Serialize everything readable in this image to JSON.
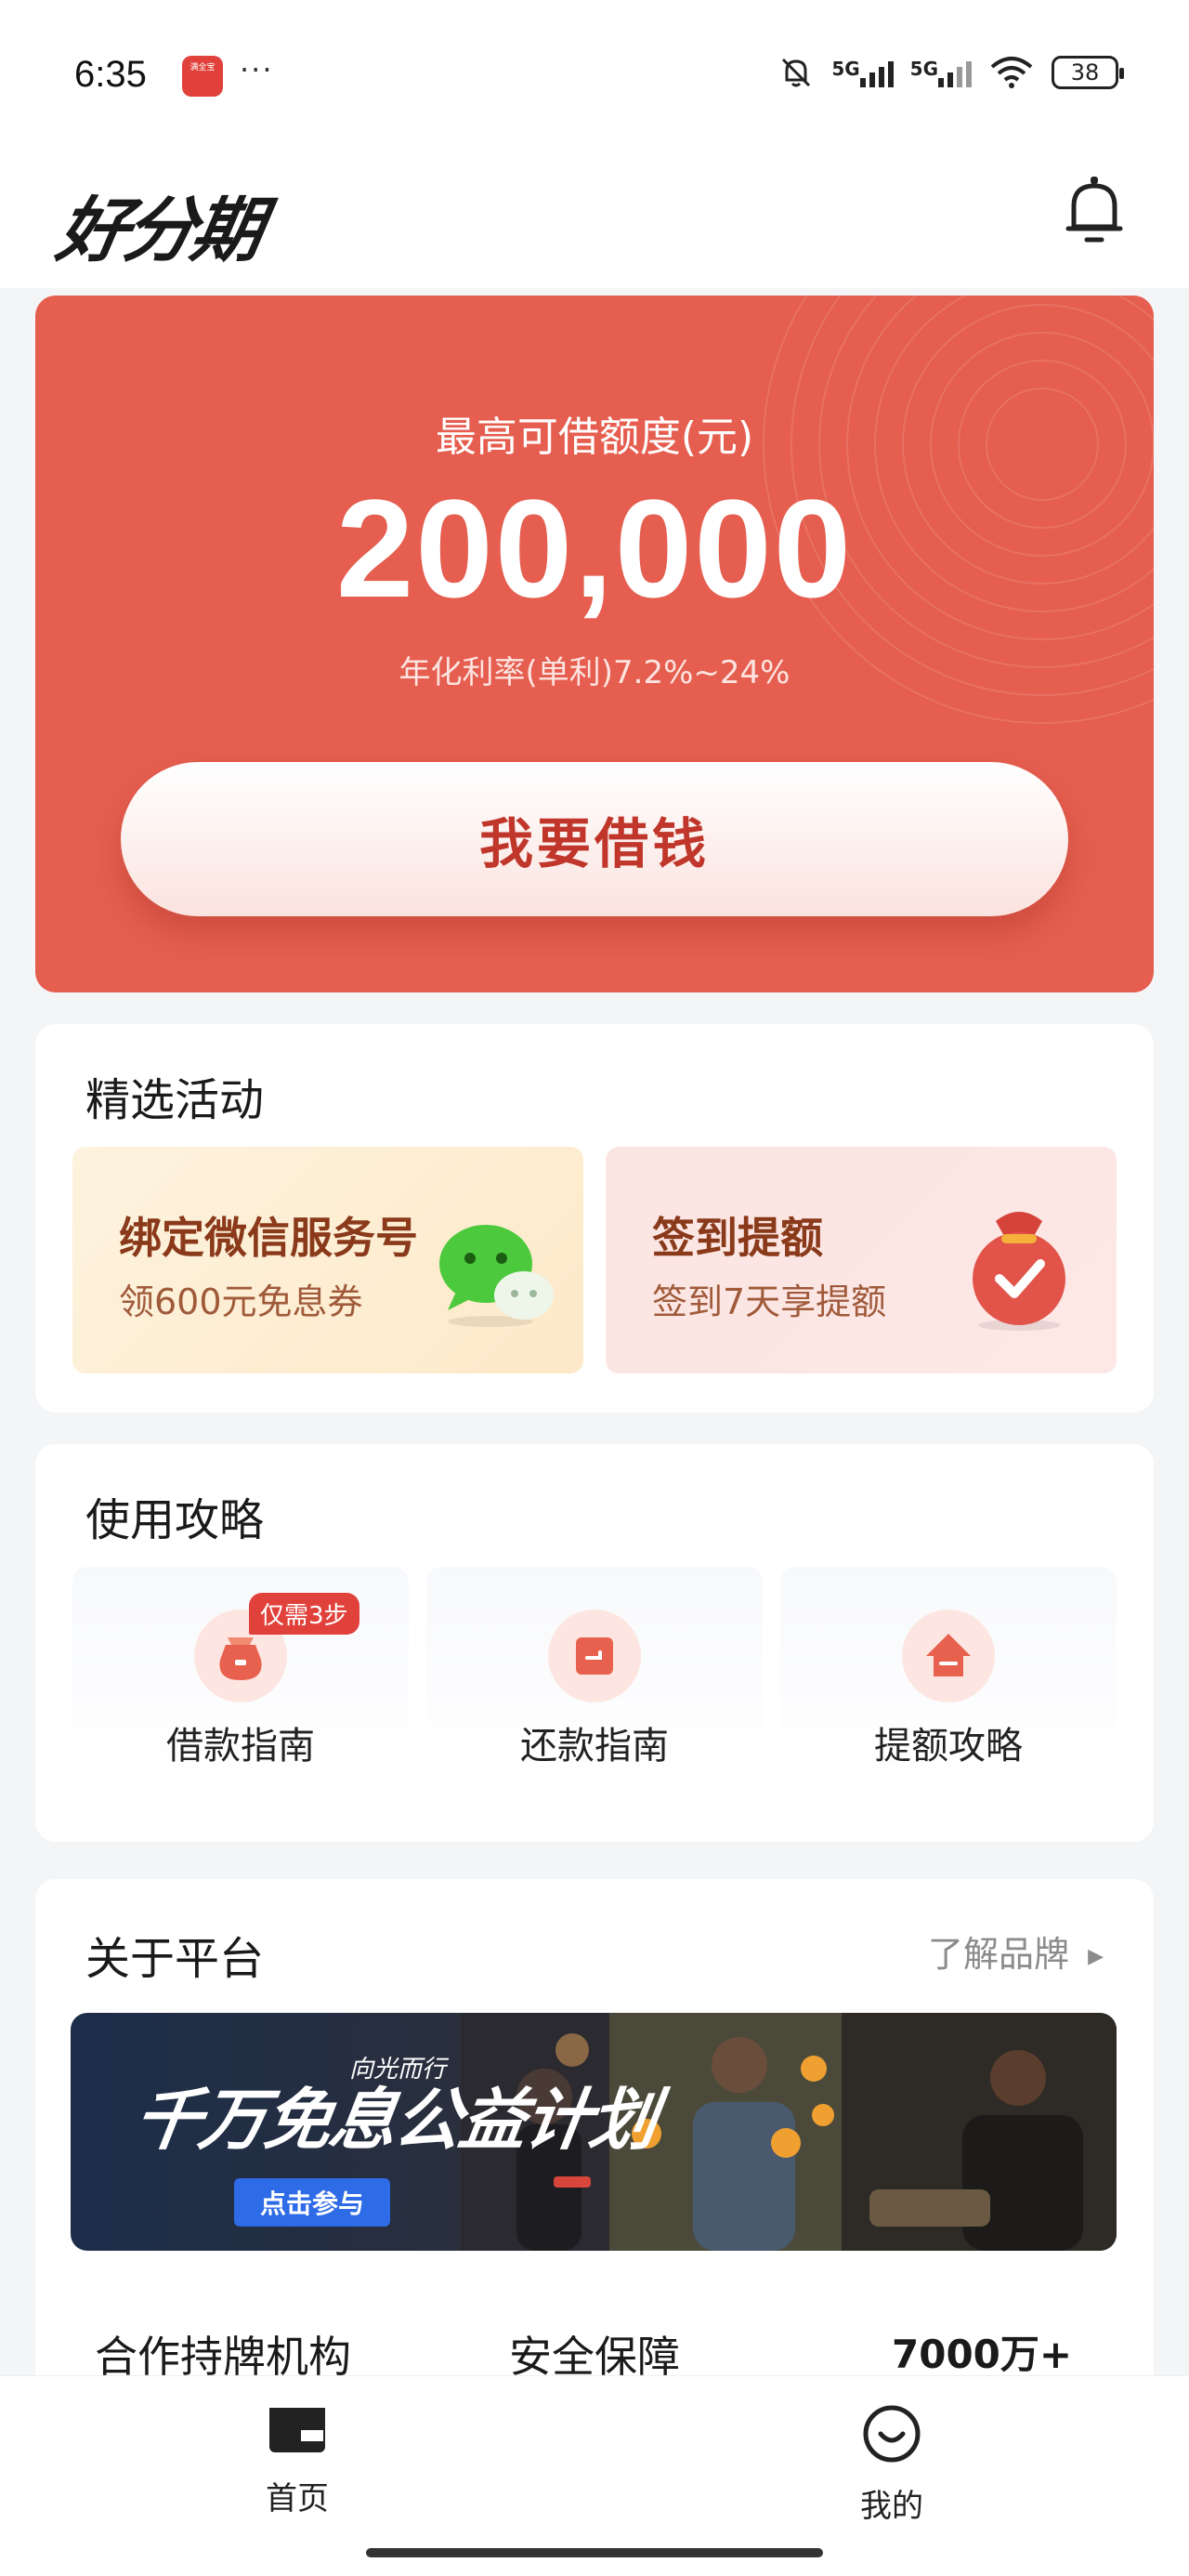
{
  "status_bar": {
    "time": "6:35",
    "app_icon_text": "满全宝",
    "more": "···",
    "network_1": "5G",
    "network_2": "5G",
    "battery": "38"
  },
  "header": {
    "logo": "好分期",
    "bell_icon": "bell-icon"
  },
  "hero": {
    "title": "最高可借额度(元)",
    "amount": "200,000",
    "rate": "年化利率(单利)7.2%~24%",
    "cta": "我要借钱"
  },
  "activities": {
    "title": "精选活动",
    "items": [
      {
        "title": "绑定微信服务号",
        "subtitle": "领600元免息券",
        "icon": "wechat-icon"
      },
      {
        "title": "签到提额",
        "subtitle": "签到7天享提额",
        "icon": "money-bag-check-icon"
      }
    ]
  },
  "guides": {
    "title": "使用攻略",
    "badge": "仅需3步",
    "items": [
      {
        "label": "借款指南",
        "icon": "bag-icon"
      },
      {
        "label": "还款指南",
        "icon": "wallet-icon"
      },
      {
        "label": "提额攻略",
        "icon": "house-up-icon"
      }
    ]
  },
  "platform": {
    "title": "关于平台",
    "more": "了解品牌",
    "banner": {
      "title": "千万免息公益计划",
      "subtitle": "向光而行",
      "button": "点击参与"
    },
    "stats": [
      "合作持牌机构",
      "安全保障",
      "7000万+"
    ]
  },
  "bottom_nav": {
    "items": [
      {
        "label": "首页",
        "icon": "wallet-icon",
        "active": true
      },
      {
        "label": "我的",
        "icon": "smile-icon",
        "active": false
      }
    ]
  },
  "colors": {
    "brand": "#e55e4f",
    "cta_text": "#c0362b",
    "badge": "#e0413a"
  }
}
